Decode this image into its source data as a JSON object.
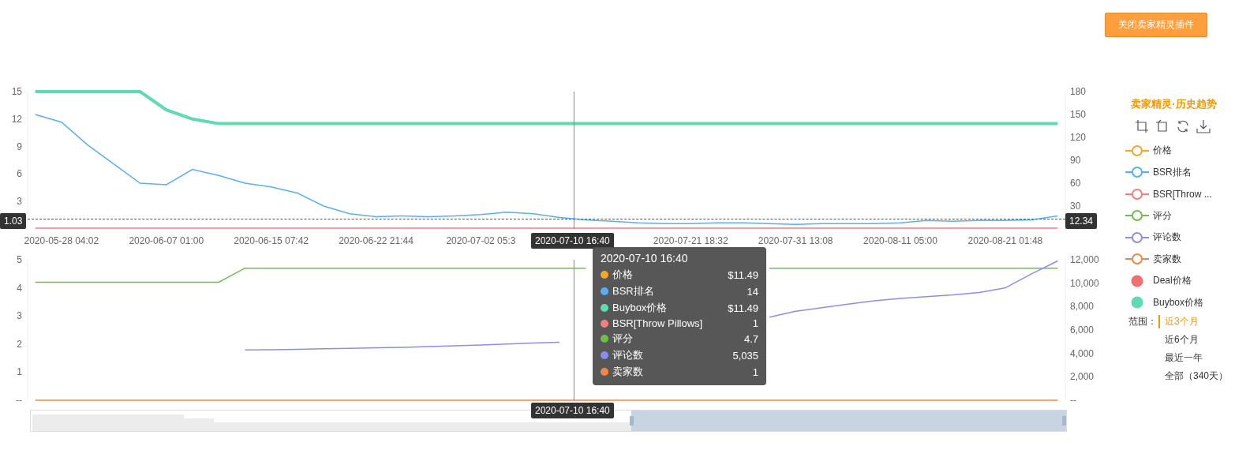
{
  "header": {
    "close_button": "关闭卖家精灵插件"
  },
  "top_chart": {
    "chart_data": {
      "type": "line",
      "categories": [
        null,
        "2020-05-28 04:02",
        null,
        null,
        null,
        "2020-06-07 01:00",
        null,
        null,
        null,
        "2020-06-15 07:42",
        null,
        null,
        null,
        "2020-06-22 21:44",
        null,
        null,
        null,
        "2020-07-02 05:3",
        null,
        null,
        null,
        null,
        null,
        null,
        null,
        "2020-07-21 18:32",
        null,
        null,
        null,
        "2020-07-31 13:08",
        null,
        null,
        null,
        "2020-08-11 05:00",
        null,
        null,
        null,
        "2020-08-21 01:48",
        null,
        null
      ],
      "ylim": [
        0,
        15
      ],
      "y2lim": [
        0,
        180
      ],
      "yticks": [
        3,
        6,
        9,
        12,
        15
      ],
      "y2ticks": [
        30,
        60,
        90,
        120,
        150,
        180
      ],
      "series": [
        {
          "name": "BSR排名",
          "color": "#5aaef5",
          "axis": "y2",
          "values": [
            150,
            140,
            110,
            85,
            60,
            58,
            78,
            70,
            60,
            55,
            47,
            30,
            20,
            16,
            17,
            16,
            17,
            19,
            22,
            20,
            15,
            12,
            10,
            8,
            7,
            7,
            8,
            8,
            7,
            6,
            7,
            7,
            7,
            8,
            11,
            10,
            11,
            11,
            12,
            17
          ]
        },
        {
          "name": "Buybox价格",
          "color": "#5fdbb0",
          "values": [
            15,
            15,
            15,
            15,
            15,
            13,
            12,
            11.5,
            11.5,
            11.5,
            11.5,
            11.5,
            11.5,
            11.5,
            11.5,
            11.5,
            11.5,
            11.5,
            11.5,
            11.5,
            11.5,
            11.5,
            11.5,
            11.5,
            11.5,
            11.5,
            11.5,
            11.5,
            11.5,
            11.5,
            11.5,
            11.5,
            11.5,
            11.5,
            11.5,
            11.5,
            11.5,
            11.5,
            11.5,
            11.5
          ]
        },
        {
          "name": "BSR[Throw Pillows]",
          "color": "#f08080",
          "axis": "y2",
          "values": [
            1,
            1,
            1,
            1,
            1,
            1,
            1,
            1,
            1,
            1,
            1,
            1,
            1,
            1,
            1,
            1,
            1,
            1,
            1,
            1,
            1,
            1,
            1,
            1,
            1,
            1,
            1,
            1,
            1,
            1,
            1,
            1,
            1,
            1,
            1,
            1,
            1,
            1,
            1,
            1
          ]
        }
      ]
    }
  },
  "bottom_chart": {
    "chart_data": {
      "type": "line",
      "categories": [
        null,
        null,
        null,
        null,
        null,
        null,
        null,
        null,
        null,
        null,
        null,
        null,
        null,
        null,
        null,
        null,
        null,
        null,
        null,
        null,
        null,
        null,
        null,
        null,
        null,
        null,
        null,
        null,
        null,
        null,
        null,
        null,
        null,
        null,
        null,
        null,
        null,
        null,
        null,
        null
      ],
      "ylim": [
        0,
        5
      ],
      "y2lim": [
        0,
        12000
      ],
      "yticks": [
        {
          "value": 0,
          "label": "--"
        },
        1,
        2,
        3,
        4,
        5
      ],
      "y2ticks": [
        {
          "value": 0,
          "label": "--"
        },
        {
          "value": 2000,
          "label": "2,000"
        },
        {
          "value": 4000,
          "label": "4,000"
        },
        {
          "value": 6000,
          "label": "6,000"
        },
        {
          "value": 8000,
          "label": "8,000"
        },
        {
          "value": 10000,
          "label": "10,000"
        },
        {
          "value": 12000,
          "label": "12,000"
        }
      ],
      "series": [
        {
          "name": "评分",
          "color": "#6cc04a",
          "values": [
            4.2,
            4.2,
            4.2,
            4.2,
            4.2,
            4.2,
            4.2,
            4.2,
            4.7,
            4.7,
            4.7,
            4.7,
            4.7,
            4.7,
            4.7,
            4.7,
            4.7,
            4.7,
            4.7,
            4.7,
            4.7,
            4.7,
            null,
            null,
            null,
            null,
            null,
            null,
            4.7,
            4.7,
            4.7,
            4.7,
            4.7,
            4.7,
            4.7,
            4.7,
            4.7,
            4.7,
            4.7,
            4.7
          ]
        },
        {
          "name": "评论数",
          "color": "#8c8cf0",
          "axis": "y2",
          "values": [
            null,
            null,
            null,
            null,
            null,
            null,
            null,
            null,
            4300,
            4320,
            4350,
            4400,
            4430,
            4480,
            4520,
            4580,
            4650,
            4720,
            4800,
            4880,
            4950,
            null,
            null,
            null,
            null,
            null,
            null,
            null,
            7100,
            7600,
            7900,
            8200,
            8500,
            8700,
            8850,
            9000,
            9200,
            9600,
            10800,
            11900
          ]
        },
        {
          "name": "卖家数",
          "color": "#f0874a",
          "axis": "y2",
          "values": [
            1,
            1,
            1,
            1,
            1,
            1,
            1,
            1,
            1,
            1,
            1,
            1,
            1,
            1,
            1,
            1,
            1,
            1,
            1,
            1,
            1,
            1,
            1,
            1,
            1,
            1,
            1,
            1,
            1,
            1,
            1,
            1,
            1,
            1,
            1,
            1,
            1,
            1,
            1,
            1
          ]
        }
      ]
    }
  },
  "zoom_slider": {
    "level": 0.42
  },
  "axis_pointer": {
    "left_value": "1.03",
    "right_value": "12.34",
    "x_label_top": "2020-07-10 16:40",
    "x_label_bottom": "2020-07-10 16:40"
  },
  "tooltip": {
    "title": "2020-07-10 16:40",
    "rows": [
      {
        "label": "价格",
        "color": "#f5a623",
        "value": "$11.49"
      },
      {
        "value": "14"
      },
      {
        "value": "$11.49"
      },
      {
        "value": "1"
      },
      {
        "value": "4.7"
      },
      {
        "value": "5,035"
      },
      {
        "value": "1"
      }
    ]
  },
  "sidebar": {
    "title": "卖家精灵·历史趋势",
    "legend": [
      {
        "label": "价格",
        "color": "#f5a623",
        "kind": "line"
      },
      {
        "label": "BSR排名",
        "color": "#5aaef5",
        "kind": "line"
      },
      {
        "label": "BSR[Throw ...",
        "color": "#f08080",
        "kind": "line"
      },
      {
        "label": "评分",
        "color": "#6cc04a",
        "kind": "line"
      },
      {
        "label": "评论数",
        "color": "#8c8cf0",
        "kind": "line"
      },
      {
        "label": "卖家数",
        "color": "#f0874a",
        "kind": "line"
      },
      {
        "label": "Deal价格",
        "color": "#f07070",
        "kind": "dot"
      },
      {
        "label": "Buybox价格",
        "color": "#5fdbb0",
        "kind": "dot"
      }
    ],
    "range": {
      "label": "范围：",
      "options": [
        {
          "label": "近3个月",
          "selected": true
        },
        {
          "label": "近6个月",
          "selected": false
        },
        {
          "label": "最近一年",
          "selected": false
        },
        {
          "label": "全部（340天）",
          "selected": false
        }
      ]
    }
  }
}
